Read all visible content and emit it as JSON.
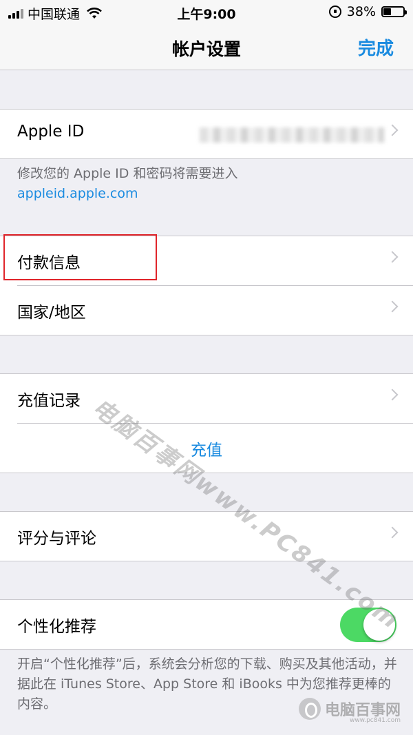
{
  "status_bar": {
    "carrier": "中国联通",
    "time": "上午9:00",
    "battery_text": "38%",
    "battery_level": 0.38
  },
  "nav": {
    "title": "帐户设置",
    "done_label": "完成"
  },
  "apple_id": {
    "label": "Apple ID"
  },
  "apple_id_note": {
    "text": "修改您的 Apple ID 和密码将需要进入",
    "link": "appleid.apple.com"
  },
  "payment": {
    "label": "付款信息"
  },
  "region": {
    "label": "国家/地区"
  },
  "purchase": {
    "history_label": "充值记录",
    "topup_label": "充值"
  },
  "ratings": {
    "label": "评分与评论"
  },
  "personalized": {
    "label": "个性化推荐",
    "enabled": true,
    "toggle_color": "#4cd964",
    "note": "开启“个性化推荐”后，系统会分析您的下载、购买及其他活动，并据此在 iTunes Store、App Store 和 iBooks 中为您推荐更棒的内容。"
  },
  "watermark": {
    "text": "电脑百事网www.PC841.com"
  },
  "logo": {
    "main": "电脑百事网",
    "sub": "www.pc841.com"
  },
  "colors": {
    "accent": "#1a8be0",
    "highlight": "#e0242a",
    "background": "#efeff4"
  }
}
